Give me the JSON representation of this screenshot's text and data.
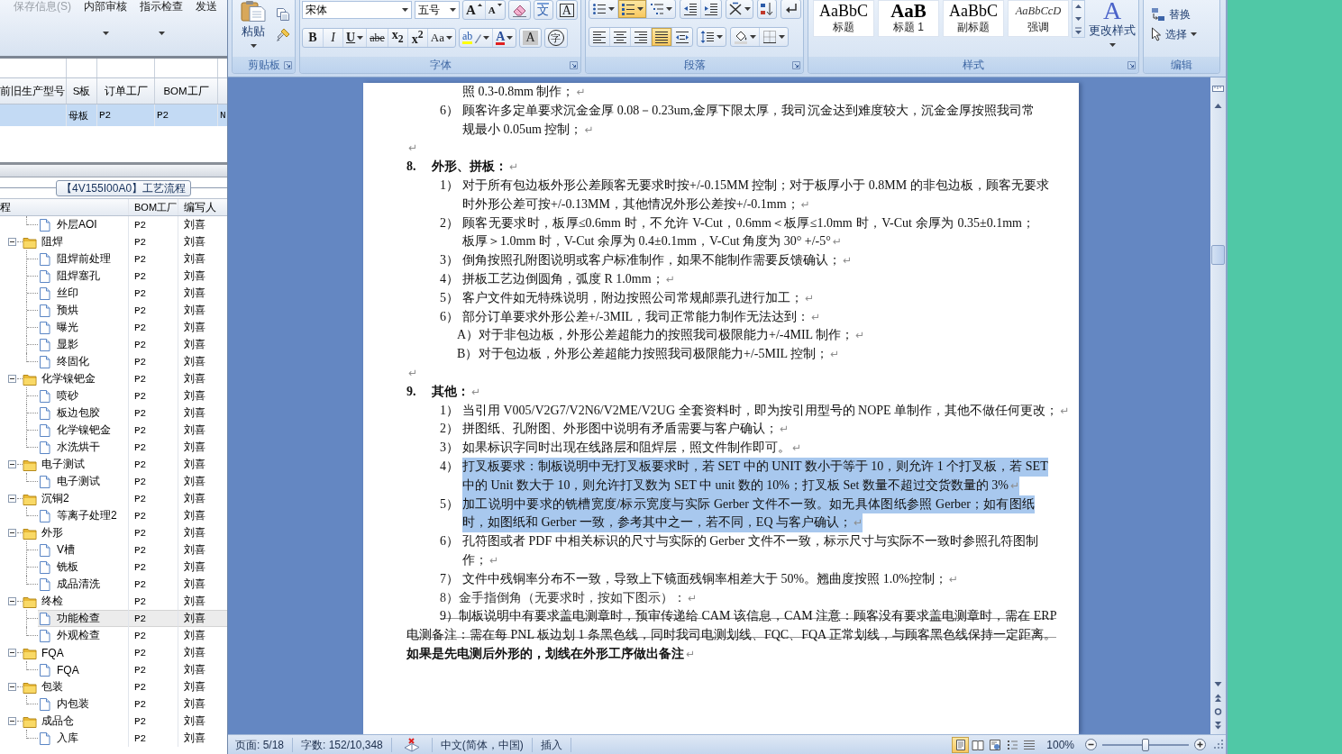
{
  "erp": {
    "toolbar": [
      {
        "label": "保存信息(S)",
        "disabled": true,
        "dropdown": false
      },
      {
        "label": "内部审核",
        "disabled": false,
        "dropdown": true
      },
      {
        "label": "指示检查",
        "disabled": false,
        "dropdown": true
      },
      {
        "label": "发送",
        "disabled": false,
        "dropdown": false
      }
    ],
    "grid": {
      "columns": [
        "前旧生产型号",
        "S板",
        "订单工厂",
        "BOM工厂"
      ],
      "rows": [
        {
          "selected": true,
          "cells": [
            "",
            "母板",
            "P2",
            "P2",
            "N"
          ]
        }
      ]
    },
    "process_panel": {
      "title": "【4V155I00A0】工艺流程",
      "columns": [
        "程",
        "BOM工厂",
        "编写人"
      ],
      "rows": [
        {
          "kind": "folder",
          "children": [
            {
              "kind": "file",
              "label": "外层AOI",
              "bom": "P2",
              "writer": "刘喜",
              "selected": false
            }
          ]
        },
        {
          "kind": "folder",
          "label": "阻焊",
          "bom": "P2",
          "writer": "刘喜",
          "expanded": true,
          "selected": false,
          "children": [
            {
              "kind": "file",
              "label": "阻焊前处理",
              "bom": "P2",
              "writer": "刘喜",
              "selected": false
            },
            {
              "kind": "file",
              "label": "阻焊塞孔",
              "bom": "P2",
              "writer": "刘喜",
              "selected": false
            },
            {
              "kind": "file",
              "label": "丝印",
              "bom": "P2",
              "writer": "刘喜",
              "selected": false
            },
            {
              "kind": "file",
              "label": "预烘",
              "bom": "P2",
              "writer": "刘喜",
              "selected": false
            },
            {
              "kind": "file",
              "label": "曝光",
              "bom": "P2",
              "writer": "刘喜",
              "selected": false
            },
            {
              "kind": "file",
              "label": "显影",
              "bom": "P2",
              "writer": "刘喜",
              "selected": false
            },
            {
              "kind": "file",
              "label": "终固化",
              "bom": "P2",
              "writer": "刘喜",
              "selected": false
            }
          ]
        },
        {
          "kind": "folder",
          "label": "化学镍钯金",
          "bom": "P2",
          "writer": "刘喜",
          "expanded": true,
          "selected": false,
          "children": [
            {
              "kind": "file",
              "label": "喷砂",
              "bom": "P2",
              "writer": "刘喜",
              "selected": false
            },
            {
              "kind": "file",
              "label": "板边包胶",
              "bom": "P2",
              "writer": "刘喜",
              "selected": false
            },
            {
              "kind": "file",
              "label": "化学镍钯金",
              "bom": "P2",
              "writer": "刘喜",
              "selected": false
            },
            {
              "kind": "file",
              "label": "水洗烘干",
              "bom": "P2",
              "writer": "刘喜",
              "selected": false
            }
          ]
        },
        {
          "kind": "folder",
          "label": "电子测试",
          "bom": "P2",
          "writer": "刘喜",
          "expanded": true,
          "selected": false,
          "children": [
            {
              "kind": "file",
              "label": "电子测试",
              "bom": "P2",
              "writer": "刘喜",
              "selected": false
            }
          ]
        },
        {
          "kind": "folder",
          "label": "沉铜2",
          "bom": "P2",
          "writer": "刘喜",
          "expanded": true,
          "selected": false,
          "children": [
            {
              "kind": "file",
              "label": "等离子处理2",
              "bom": "P2",
              "writer": "刘喜",
              "selected": false
            }
          ]
        },
        {
          "kind": "folder",
          "label": "外形",
          "bom": "P2",
          "writer": "刘喜",
          "expanded": true,
          "selected": false,
          "children": [
            {
              "kind": "file",
              "label": "V槽",
              "bom": "P2",
              "writer": "刘喜",
              "selected": false
            },
            {
              "kind": "file",
              "label": "铣板",
              "bom": "P2",
              "writer": "刘喜",
              "selected": false
            },
            {
              "kind": "file",
              "label": "成品清洗",
              "bom": "P2",
              "writer": "刘喜",
              "selected": false
            }
          ]
        },
        {
          "kind": "folder",
          "label": "终检",
          "bom": "P2",
          "writer": "刘喜",
          "expanded": true,
          "selected": false,
          "children": [
            {
              "kind": "file",
              "label": "功能检查",
              "bom": "P2",
              "writer": "刘喜",
              "selected": true
            },
            {
              "kind": "file",
              "label": "外观检查",
              "bom": "P2",
              "writer": "刘喜",
              "selected": false
            }
          ]
        },
        {
          "kind": "folder",
          "label": "FQA",
          "bom": "P2",
          "writer": "刘喜",
          "expanded": true,
          "selected": false,
          "children": [
            {
              "kind": "file",
              "label": "FQA",
              "bom": "P2",
              "writer": "刘喜",
              "selected": false
            }
          ]
        },
        {
          "kind": "folder",
          "label": "包装",
          "bom": "P2",
          "writer": "刘喜",
          "expanded": true,
          "selected": false,
          "children": [
            {
              "kind": "file",
              "label": "内包装",
              "bom": "P2",
              "writer": "刘喜",
              "selected": false
            }
          ]
        },
        {
          "kind": "folder",
          "label": "成品仓",
          "bom": "P2",
          "writer": "刘喜",
          "expanded": true,
          "selected": false,
          "children": [
            {
              "kind": "file",
              "label": "入库",
              "bom": "P2",
              "writer": "刘喜",
              "selected": false
            }
          ]
        }
      ]
    }
  },
  "word": {
    "ribbon": {
      "clipboard": {
        "label": "剪贴板",
        "paste": "粘贴"
      },
      "font": {
        "label": "字体",
        "font_name": "宋体",
        "font_size": "五号",
        "row1": [
          [
            {
              "kind": "grow",
              "glyph": "A"
            },
            {
              "kind": "shrink",
              "glyph": "A"
            }
          ],
          [
            {
              "kind": "clear"
            }
          ],
          [
            {
              "kind": "phonetic",
              "glyph": "文"
            }
          ],
          [
            {
              "kind": "border",
              "glyph": "A"
            }
          ]
        ],
        "row2": [
          [
            {
              "kind": "bold",
              "glyph": "B"
            },
            {
              "kind": "italic",
              "glyph": "I"
            },
            {
              "kind": "underline",
              "glyph": "U",
              "dropdown": true
            },
            {
              "kind": "strike",
              "glyph": "abe"
            },
            {
              "kind": "subscript",
              "glyph": "x$_{2}$"
            },
            {
              "kind": "superscript",
              "glyph": "x$^{2}$"
            },
            {
              "kind": "case",
              "glyph": "Aa",
              "dropdown": true
            }
          ],
          [
            {
              "kind": "highlight",
              "glyph": "ab",
              "dropdown": true
            },
            {
              "kind": "color",
              "glyph": "A",
              "dropdown": true
            }
          ],
          [
            {
              "kind": "shading",
              "glyph": "A"
            }
          ],
          [
            {
              "kind": "enclose",
              "glyph": "字"
            }
          ]
        ]
      },
      "paragraph": {
        "label": "段落",
        "row1": [
          [
            {
              "kind": "bullets",
              "dropdown": true,
              "on": false
            },
            {
              "kind": "numbering",
              "dropdown": true,
              "on": true
            },
            {
              "kind": "multilevel",
              "dropdown": true,
              "on": false
            }
          ],
          [
            {
              "kind": "outdent",
              "on": false
            },
            {
              "kind": "indent",
              "on": false
            }
          ],
          [
            {
              "kind": "asian-layout",
              "dropdown": true,
              "on": false
            }
          ],
          [
            {
              "kind": "sort",
              "on": false
            }
          ],
          [
            {
              "kind": "marks",
              "on": false
            }
          ]
        ],
        "row2": [
          [
            {
              "kind": "align-left",
              "on": false
            },
            {
              "kind": "center",
              "on": false
            },
            {
              "kind": "align-right",
              "on": false
            },
            {
              "kind": "justify",
              "on": true
            },
            {
              "kind": "distribute",
              "on": false
            }
          ],
          [
            {
              "kind": "line-spacing",
              "dropdown": true,
              "on": false
            }
          ],
          [
            {
              "kind": "shading",
              "dropdown": true,
              "on": false
            },
            {
              "kind": "borders",
              "dropdown": true,
              "on": false
            }
          ]
        ]
      },
      "styles": {
        "label": "样式",
        "gallery": [
          {
            "kind": "title",
            "sample": "AaBbC",
            "name": "标题"
          },
          {
            "kind": "heading",
            "sample": "AaB",
            "name": "标题 1"
          },
          {
            "kind": "subtitle",
            "sample": "AaBbC",
            "name": "副标题"
          },
          {
            "kind": "emphasis",
            "sample": "AaBbCcD",
            "name": "强调"
          }
        ],
        "change_styles": {
          "glyph": "A",
          "label": "更改样式"
        }
      },
      "editing": {
        "label": "编辑",
        "items": [
          {
            "kind": "replace",
            "label": "替换"
          },
          {
            "kind": "select",
            "label": "选择",
            "dropdown": true
          }
        ]
      }
    },
    "document": {
      "paragraphs": [
        {
          "kind": "continuation",
          "lines": [
            "照 0.3-0.8mm 制作；"
          ],
          "mark": "↵",
          "selected": false,
          "struck": false
        },
        {
          "kind": "item",
          "number": "6）",
          "lines": [
            "顾客许多定单要求沉金金厚 0.08－0.23um,金厚下限太厚，我司沉金达到难度较大，沉金金厚按照我司常",
            "规最小 0.05um 控制；"
          ],
          "mark": "↵",
          "selected": false,
          "struck": false
        },
        {
          "kind": "empty",
          "mark": "↵",
          "selected": false,
          "struck": false
        },
        {
          "kind": "heading",
          "number": "8.",
          "lines": [
            "外形、拼板："
          ],
          "mark": "↵",
          "selected": false,
          "struck": false
        },
        {
          "kind": "item",
          "number": "1）",
          "lines": [
            "对于所有包边板外形公差顾客无要求时按+/-0.15MM 控制；对于板厚小于 0.8MM 的非包边板，顾客无要求",
            "时外形公差可按+/-0.13MM，其他情况外形公差按+/-0.1mm；"
          ],
          "mark": "↵",
          "selected": false,
          "struck": false
        },
        {
          "kind": "item",
          "number": "2）",
          "lines": [
            "顾客无要求时，板厚≤0.6mm 时，不允许 V-Cut，0.6mm＜板厚≤1.0mm 时，V-Cut 余厚为 0.35±0.1mm；",
            "板厚＞1.0mm 时，V-Cut 余厚为 0.4±0.1mm，V-Cut 角度为 30° +/-5°"
          ],
          "mark": "↵",
          "selected": false,
          "struck": false
        },
        {
          "kind": "item",
          "number": "3）",
          "lines": [
            "倒角按照孔附图说明或客户标准制作，如果不能制作需要反馈确认；"
          ],
          "mark": "↵",
          "selected": false,
          "struck": false
        },
        {
          "kind": "item",
          "number": "4）",
          "lines": [
            "拼板工艺边倒圆角，弧度 R 1.0mm；"
          ],
          "mark": "↵",
          "selected": false,
          "struck": false
        },
        {
          "kind": "item",
          "number": "5）",
          "lines": [
            "客户文件如无特殊说明，附边按照公司常规邮票孔进行加工；"
          ],
          "mark": "↵",
          "selected": false,
          "struck": false
        },
        {
          "kind": "item",
          "number": "6）",
          "lines": [
            "部分订单要求外形公差+/-3MIL，我司正常能力制作无法达到："
          ],
          "mark": "↵",
          "selected": false,
          "struck": false
        },
        {
          "kind": "sub",
          "number": "A）",
          "lines": [
            "对于非包边板，外形公差超能力的按照我司极限能力+/-4MIL 制作；"
          ],
          "mark": "↵",
          "selected": false,
          "struck": false
        },
        {
          "kind": "sub",
          "number": "B）",
          "lines": [
            "对于包边板，外形公差超能力按照我司极限能力+/-5MIL 控制；"
          ],
          "mark": "↵",
          "selected": false,
          "struck": false
        },
        {
          "kind": "empty",
          "mark": "↵",
          "selected": false,
          "struck": false
        },
        {
          "kind": "heading",
          "number": "9.",
          "lines": [
            "其他："
          ],
          "mark": "↵",
          "selected": false,
          "struck": false
        },
        {
          "kind": "item",
          "number": "1）",
          "lines": [
            "当引用 V005/V2G7/V2N6/V2ME/V2UG 全套资料时，即为按引用型号的 NOPE 单制作，其他不做任何更改；"
          ],
          "mark": "↵",
          "selected": false,
          "struck": false
        },
        {
          "kind": "item",
          "number": "2）",
          "lines": [
            "拼图纸、孔附图、外形图中说明有矛盾需要与客户确认；"
          ],
          "mark": "↵",
          "selected": false,
          "struck": false
        },
        {
          "kind": "item",
          "number": "3）",
          "lines": [
            "如果标识字同时出现在线路层和阻焊层，照文件制作即可。"
          ],
          "mark": "↵",
          "selected": false,
          "struck": false
        },
        {
          "kind": "item",
          "number": "4）",
          "lines": [
            "打叉板要求：制板说明中无打叉板要求时，若 SET 中的 UNIT 数小于等于 10，则允许 1 个打叉板，若 SET",
            "中的 Unit 数大于 10，则允许打叉数为 SET 中 unit 数的 10%；打叉板 Set 数量不超过交货数量的 3%"
          ],
          "mark": "↵",
          "selected": true,
          "struck": false
        },
        {
          "kind": "item",
          "number": "5）",
          "lines": [
            "加工说明中要求的铣槽宽度/标示宽度与实际 Gerber 文件不一致。如无具体图纸参照 Gerber；如有图纸",
            "时，如图纸和 Gerber 一致，参考其中之一，若不同，EQ 与客户确认；"
          ],
          "mark": "↵",
          "selected": true,
          "struck": false
        },
        {
          "kind": "item",
          "number": "6）",
          "lines": [
            "孔符图或者 PDF 中相关标识的尺寸与实际的 Gerber 文件不一致，标示尺寸与实际不一致时参照孔符图制",
            "作；"
          ],
          "mark": "↵",
          "selected": false,
          "struck": false
        },
        {
          "kind": "item",
          "number": "7）",
          "lines": [
            "文件中残铜率分布不一致，导致上下镜面残铜率相差大于 50%。翘曲度按照 1.0%控制；"
          ],
          "mark": "↵",
          "selected": false,
          "struck": false
        },
        {
          "kind": "indented",
          "lines": [
            "8）金手指倒角（无要求时，按如下图示）："
          ],
          "mark": "↵",
          "selected": false,
          "struck": false
        },
        {
          "kind": "indented",
          "lines": [
            "9）制板说明中有要求盖电测章时，预审传递给 CAM 该信息，CAM 注意：顾客没有要求盖电测章时，需在 ERP",
            "电测备注：需在每 PNL 板边划 1 条黑色线，同时我司电测划线、FQC、FQA 正常划线，与顾客黑色线保持一定距离。"
          ],
          "selected": false,
          "struck": true
        },
        {
          "kind": "note",
          "lines": [
            "如果是先电测后外形的，划线在外形工序做出备注"
          ],
          "mark": "↵",
          "selected": false,
          "struck": false
        }
      ]
    },
    "status_bar": {
      "page": "页面: 5/18",
      "words": "字数: 152/10,348",
      "language": "中文(简体，中国)",
      "mode": "插入",
      "views": [
        {
          "kind": "print",
          "selected": true
        },
        {
          "kind": "reading",
          "selected": false
        },
        {
          "kind": "web",
          "selected": false
        },
        {
          "kind": "outline",
          "selected": false
        },
        {
          "kind": "draft",
          "selected": false
        }
      ],
      "zoom": "100%",
      "zoom_slider": {
        "level": 0.5
      }
    }
  }
}
